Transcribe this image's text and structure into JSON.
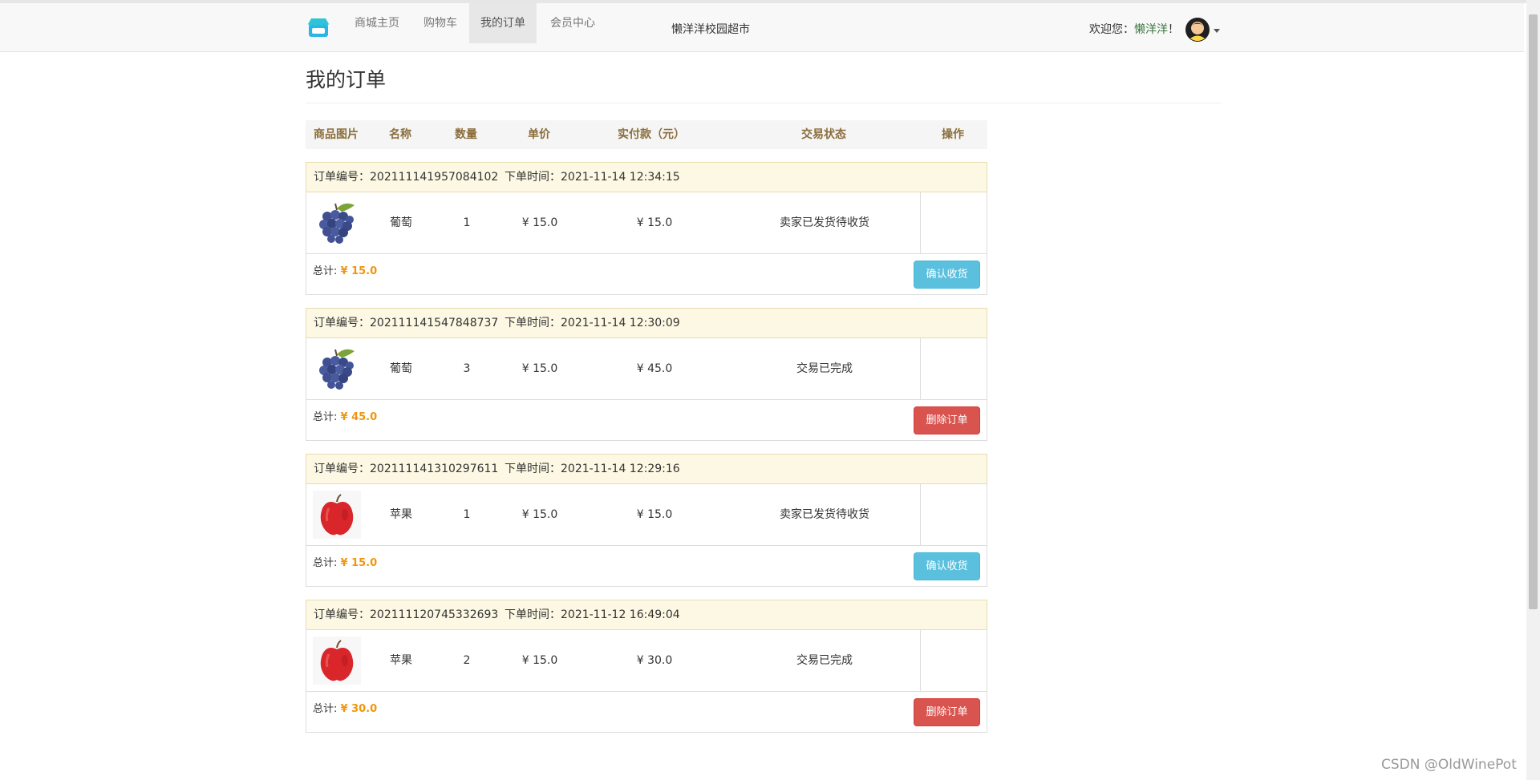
{
  "nav": {
    "items": [
      {
        "label": "商城主页"
      },
      {
        "label": "购物车"
      },
      {
        "label": "我的订单"
      },
      {
        "label": "会员中心"
      }
    ],
    "brand": "懒洋洋校园超市",
    "welcome_prefix": "欢迎您：",
    "username": "懒洋洋",
    "welcome_suffix": "！"
  },
  "page": {
    "title": "我的订单"
  },
  "table": {
    "headers": [
      "商品图片",
      "名称",
      "数量",
      "单价",
      "实付款（元）",
      "交易状态",
      "操作"
    ]
  },
  "orders": [
    {
      "no_label": "订单编号：202111141957084102",
      "time_label": "下单时间：2021-11-14 12:34:15",
      "product": "葡萄",
      "image": "grape-image",
      "qty": "1",
      "price": "¥ 15.0",
      "paid": "¥ 15.0",
      "status": "卖家已发货待收货",
      "total_label": "总计: ",
      "total": "¥ 15.0",
      "action": "确认收货",
      "action_type": "info"
    },
    {
      "no_label": "订单编号：202111141547848737",
      "time_label": "下单时间：2021-11-14 12:30:09",
      "product": "葡萄",
      "image": "grape-image",
      "qty": "3",
      "price": "¥ 15.0",
      "paid": "¥ 45.0",
      "status": "交易已完成",
      "total_label": "总计: ",
      "total": "¥ 45.0",
      "action": "删除订单",
      "action_type": "danger"
    },
    {
      "no_label": "订单编号：202111141310297611",
      "time_label": "下单时间：2021-11-14 12:29:16",
      "product": "苹果",
      "image": "apple-image",
      "qty": "1",
      "price": "¥ 15.0",
      "paid": "¥ 15.0",
      "status": "卖家已发货待收货",
      "total_label": "总计: ",
      "total": "¥ 15.0",
      "action": "确认收货",
      "action_type": "info"
    },
    {
      "no_label": "订单编号：202111120745332693",
      "time_label": "下单时间：2021-11-12 16:49:04",
      "product": "苹果",
      "image": "apple-image",
      "qty": "2",
      "price": "¥ 15.0",
      "paid": "¥ 30.0",
      "status": "交易已完成",
      "total_label": "总计: ",
      "total": "¥ 30.0",
      "action": "删除订单",
      "action_type": "danger"
    }
  ],
  "colors": {
    "accent_total": "#f0960e",
    "btn_info": "#5bc0de",
    "btn_danger": "#d9534f",
    "order_header_bg": "#fcf8e3",
    "username": "#3c763d"
  },
  "watermark": "CSDN @OldWinePot"
}
